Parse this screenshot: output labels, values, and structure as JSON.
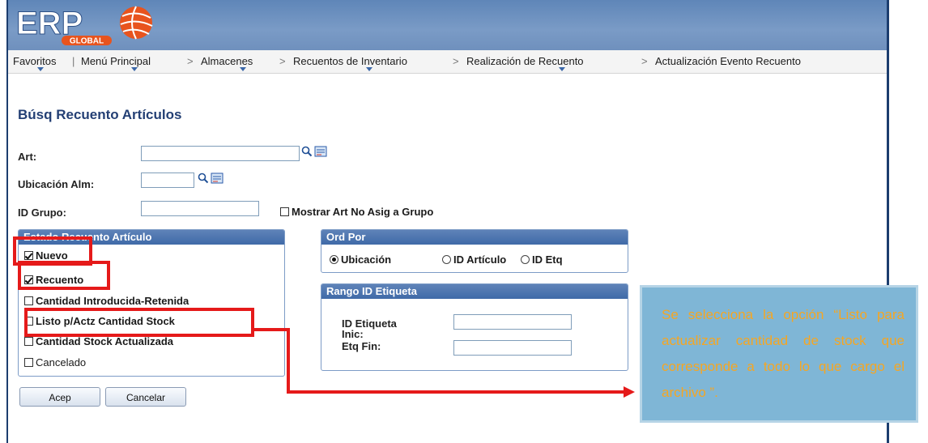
{
  "logo": {
    "text": "ERP",
    "sub": "GLOBAL"
  },
  "nav": {
    "items": [
      "Favoritos",
      "Menú Principal",
      "Almacenes",
      "Recuentos de Inventario",
      "Realización de Recuento",
      "Actualización Evento Recuento"
    ],
    "separator": ">",
    "first_separator": "|"
  },
  "page_title": "Búsq Recuento Artículos",
  "fields": {
    "art_label": "Art:",
    "art_value": "",
    "ubicacion_label": "Ubicación Alm:",
    "ubicacion_value": "",
    "grupo_label": "ID Grupo:",
    "grupo_value": "",
    "mostrar_label": "Mostrar Art No Asig a Grupo"
  },
  "estado": {
    "title": "Estado Recuento Artículo",
    "items": [
      {
        "label": "Nuevo",
        "checked": true
      },
      {
        "label": "Recuento",
        "checked": true
      },
      {
        "label": "Cantidad Introducida-Retenida",
        "checked": false
      },
      {
        "label": "Listo p/Actz Cantidad Stock",
        "checked": false
      },
      {
        "label": "Cantidad Stock Actualizada",
        "checked": false
      },
      {
        "label": "Cancelado",
        "checked": false
      }
    ]
  },
  "ord_por": {
    "title": "Ord Por",
    "options": [
      {
        "label": "Ubicación",
        "selected": true
      },
      {
        "label": "ID Artículo",
        "selected": false
      },
      {
        "label": "ID Etq",
        "selected": false
      }
    ]
  },
  "rango": {
    "title": "Rango ID Etiqueta",
    "inic_label_1": "ID Etiqueta",
    "inic_label_2": "Inic:",
    "fin_label": "Etq Fin:",
    "inic_value": "",
    "fin_value": ""
  },
  "buttons": {
    "accept": "Acep",
    "cancel": "Cancelar"
  },
  "callout": {
    "text": "Se selecciona la opción “Listo para actualizar cantidad de stock que corresponde a todo lo que cargo el archivo ”."
  },
  "colors": {
    "header": "#6f90bd",
    "title": "#233f74",
    "highlight": "#e51a1a",
    "callout_bg": "#7fb6d6",
    "callout_text": "#f5a623"
  }
}
